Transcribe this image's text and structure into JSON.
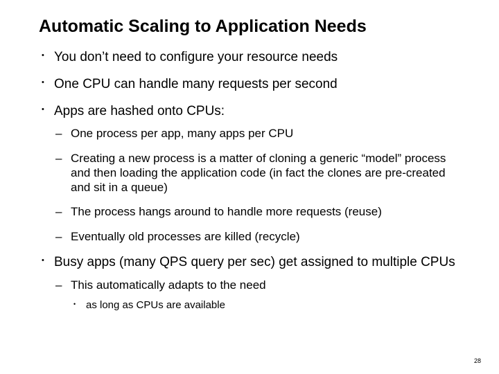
{
  "title": "Automatic Scaling to Application Needs",
  "bullets": [
    {
      "text": "You don’t need to configure your resource needs"
    },
    {
      "text": "One CPU can handle many requests per second"
    },
    {
      "text": "Apps are hashed onto CPUs:",
      "sub": [
        {
          "text": "One process per app, many apps per CPU"
        },
        {
          "text": "Creating a new process is a matter of cloning a generic “model” process and then loading the application code (in fact the clones are pre-created and sit in a queue)"
        },
        {
          "text": "The process hangs around to handle more requests (reuse)"
        },
        {
          "text": "Eventually old processes are killed (recycle)"
        }
      ]
    },
    {
      "text": "Busy apps (many QPS query per sec) get assigned to multiple CPUs",
      "sub": [
        {
          "text": "This automatically adapts to the need",
          "sub": [
            {
              "text": "as long as CPUs are available"
            }
          ]
        }
      ]
    }
  ],
  "page_number": "28"
}
